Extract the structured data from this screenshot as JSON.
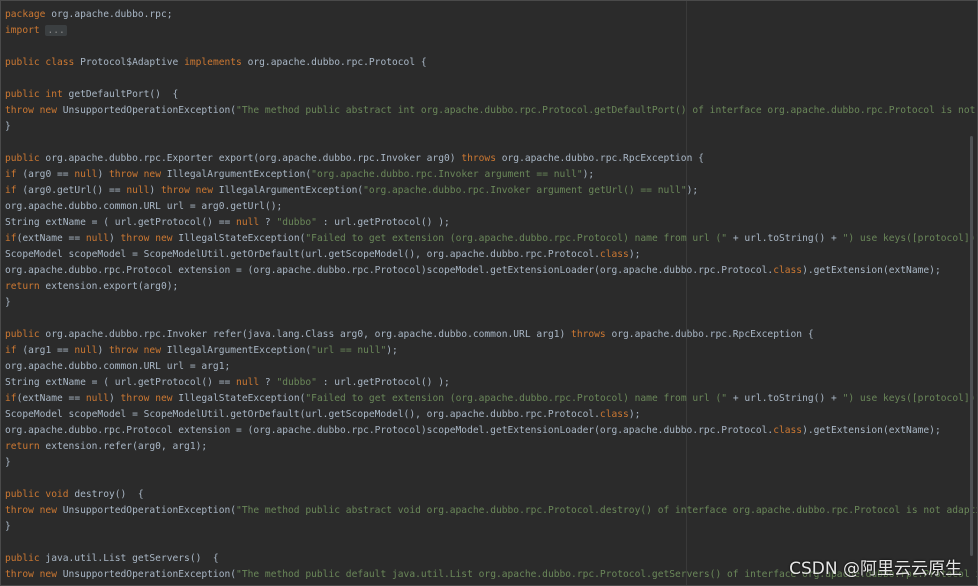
{
  "watermark": "CSDN @阿里云云原生",
  "code_lines": [
    [
      {
        "t": "package",
        "c": "k"
      },
      {
        "t": " org.apache.dubbo.rpc;"
      }
    ],
    [
      {
        "t": "import",
        "c": "k"
      },
      {
        "t": " "
      },
      {
        "t": "...",
        "c": "fold"
      }
    ],
    [],
    [
      {
        "t": "public class",
        "c": "k"
      },
      {
        "t": " Protocol$Adaptive "
      },
      {
        "t": "implements",
        "c": "k"
      },
      {
        "t": " org.apache.dubbo.rpc.Protocol {"
      }
    ],
    [],
    [
      {
        "t": "public int",
        "c": "k"
      },
      {
        "t": " getDefaultPort()  {"
      }
    ],
    [
      {
        "t": "throw new",
        "c": "k"
      },
      {
        "t": " UnsupportedOperationException("
      },
      {
        "t": "\"The method public abstract int org.apache.dubbo.rpc.Protocol.getDefaultPort() of interface org.apache.dubbo.rpc.Protocol is not ad",
        "c": "s"
      }
    ],
    [
      {
        "t": "}"
      }
    ],
    [],
    [
      {
        "t": "public",
        "c": "k"
      },
      {
        "t": " org.apache.dubbo.rpc.Exporter export(org.apache.dubbo.rpc.Invoker arg0) "
      },
      {
        "t": "throws",
        "c": "k"
      },
      {
        "t": " org.apache.dubbo.rpc.RpcException {"
      }
    ],
    [
      {
        "t": "if",
        "c": "k"
      },
      {
        "t": " (arg0 == "
      },
      {
        "t": "null",
        "c": "k"
      },
      {
        "t": ") "
      },
      {
        "t": "throw new",
        "c": "k"
      },
      {
        "t": " IllegalArgumentException("
      },
      {
        "t": "\"org.apache.dubbo.rpc.Invoker argument == null\"",
        "c": "s"
      },
      {
        "t": ");"
      }
    ],
    [
      {
        "t": "if",
        "c": "k"
      },
      {
        "t": " (arg0.getUrl() == "
      },
      {
        "t": "null",
        "c": "k"
      },
      {
        "t": ") "
      },
      {
        "t": "throw new",
        "c": "k"
      },
      {
        "t": " IllegalArgumentException("
      },
      {
        "t": "\"org.apache.dubbo.rpc.Invoker argument getUrl() == null\"",
        "c": "s"
      },
      {
        "t": ");"
      }
    ],
    [
      {
        "t": "org.apache.dubbo.common.URL url = arg0.getUrl();"
      }
    ],
    [
      {
        "t": "String extName = ( url.getProtocol() == "
      },
      {
        "t": "null",
        "c": "k"
      },
      {
        "t": " ? "
      },
      {
        "t": "\"dubbo\"",
        "c": "s"
      },
      {
        "t": " : url.getProtocol() );"
      }
    ],
    [
      {
        "t": "if",
        "c": "k"
      },
      {
        "t": "(extName == "
      },
      {
        "t": "null",
        "c": "k"
      },
      {
        "t": ") "
      },
      {
        "t": "throw new",
        "c": "k"
      },
      {
        "t": " IllegalStateException("
      },
      {
        "t": "\"Failed to get extension (org.apache.dubbo.rpc.Protocol) name from url (\"",
        "c": "s"
      },
      {
        "t": " + url.toString() + "
      },
      {
        "t": "\") use keys([protocol])\"",
        "c": "s"
      },
      {
        "t": ");"
      }
    ],
    [
      {
        "t": "ScopeModel scopeModel = ScopeModelUtil.getOrDefault(url.getScopeModel(), org.apache.dubbo.rpc.Protocol."
      },
      {
        "t": "class",
        "c": "k"
      },
      {
        "t": ");"
      }
    ],
    [
      {
        "t": "org.apache.dubbo.rpc.Protocol extension = (org.apache.dubbo.rpc.Protocol)scopeModel.getExtensionLoader(org.apache.dubbo.rpc.Protocol."
      },
      {
        "t": "class",
        "c": "k"
      },
      {
        "t": ").getExtension(extName);"
      }
    ],
    [
      {
        "t": "return",
        "c": "k"
      },
      {
        "t": " extension.export(arg0);"
      }
    ],
    [
      {
        "t": "}"
      }
    ],
    [],
    [
      {
        "t": "public",
        "c": "k"
      },
      {
        "t": " org.apache.dubbo.rpc.Invoker refer(java.lang.Class arg0, org.apache.dubbo.common.URL arg1) "
      },
      {
        "t": "throws",
        "c": "k"
      },
      {
        "t": " org.apache.dubbo.rpc.RpcException {"
      }
    ],
    [
      {
        "t": "if",
        "c": "k"
      },
      {
        "t": " (arg1 == "
      },
      {
        "t": "null",
        "c": "k"
      },
      {
        "t": ") "
      },
      {
        "t": "throw new",
        "c": "k"
      },
      {
        "t": " IllegalArgumentException("
      },
      {
        "t": "\"url == null\"",
        "c": "s"
      },
      {
        "t": ");"
      }
    ],
    [
      {
        "t": "org.apache.dubbo.common.URL url = arg1;"
      }
    ],
    [
      {
        "t": "String extName = ( url.getProtocol() == "
      },
      {
        "t": "null",
        "c": "k"
      },
      {
        "t": " ? "
      },
      {
        "t": "\"dubbo\"",
        "c": "s"
      },
      {
        "t": " : url.getProtocol() );"
      }
    ],
    [
      {
        "t": "if",
        "c": "k"
      },
      {
        "t": "(extName == "
      },
      {
        "t": "null",
        "c": "k"
      },
      {
        "t": ") "
      },
      {
        "t": "throw new",
        "c": "k"
      },
      {
        "t": " IllegalStateException("
      },
      {
        "t": "\"Failed to get extension (org.apache.dubbo.rpc.Protocol) name from url (\"",
        "c": "s"
      },
      {
        "t": " + url.toString() + "
      },
      {
        "t": "\") use keys([protocol])\"",
        "c": "s"
      },
      {
        "t": ");"
      }
    ],
    [
      {
        "t": "ScopeModel scopeModel = ScopeModelUtil.getOrDefault(url.getScopeModel(), org.apache.dubbo.rpc.Protocol."
      },
      {
        "t": "class",
        "c": "k"
      },
      {
        "t": ");"
      }
    ],
    [
      {
        "t": "org.apache.dubbo.rpc.Protocol extension = (org.apache.dubbo.rpc.Protocol)scopeModel.getExtensionLoader(org.apache.dubbo.rpc.Protocol."
      },
      {
        "t": "class",
        "c": "k"
      },
      {
        "t": ").getExtension(extName);"
      }
    ],
    [
      {
        "t": "return",
        "c": "k"
      },
      {
        "t": " extension.refer(arg0, arg1);"
      }
    ],
    [
      {
        "t": "}"
      }
    ],
    [],
    [
      {
        "t": "public void",
        "c": "k"
      },
      {
        "t": " destroy()  {"
      }
    ],
    [
      {
        "t": "throw new",
        "c": "k"
      },
      {
        "t": " UnsupportedOperationException("
      },
      {
        "t": "\"The method public abstract void org.apache.dubbo.rpc.Protocol.destroy() of interface org.apache.dubbo.rpc.Protocol is not adaptive",
        "c": "s"
      }
    ],
    [
      {
        "t": "}"
      }
    ],
    [],
    [
      {
        "t": "public",
        "c": "k"
      },
      {
        "t": " java.util.List getServers()  {"
      }
    ],
    [
      {
        "t": "throw new",
        "c": "k"
      },
      {
        "t": " UnsupportedOperationException("
      },
      {
        "t": "\"The method public default java.util.List org.apache.dubbo.rpc.Protocol.getServers() of interface org.apache.dubbo.rpc.Protocol is",
        "c": "s"
      }
    ]
  ]
}
